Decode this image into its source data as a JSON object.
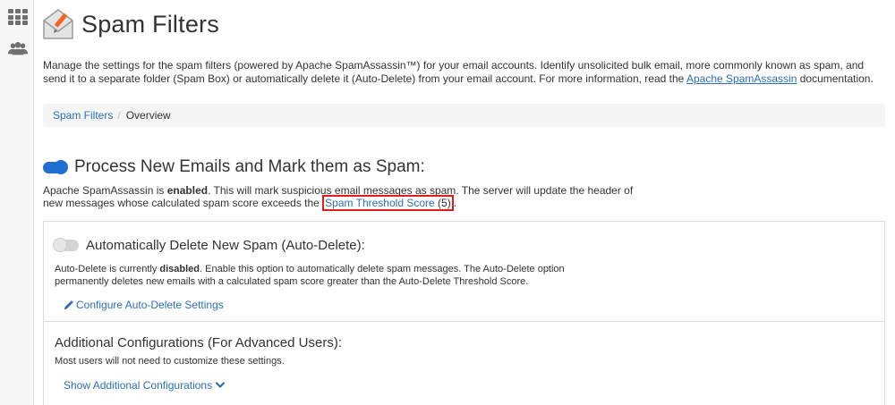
{
  "page": {
    "title": "Spam Filters",
    "description_before_link": "Manage the settings for the spam filters (powered by Apache SpamAssassin™) for your email accounts. Identify unsolicited bulk email, more commonly known as spam, and send it to a separate folder (Spam Box) or automatically delete it (Auto-Delete) from your email account. For more information, read the ",
    "description_link": "Apache SpamAssassin",
    "description_after_link": " documentation."
  },
  "breadcrumb": {
    "parent": "Spam Filters",
    "separator": "/",
    "current": "Overview"
  },
  "process": {
    "title": "Process New Emails and Mark them as Spam:",
    "enabled": true,
    "text_before_status": "Apache SpamAssassin is ",
    "status": "enabled",
    "text_after_status": ". This will mark suspicious email messages as spam. The server will update the header of new messages whose calculated spam score exceeds the ",
    "threshold_link": "Spam Threshold Score",
    "threshold_value": " (5)",
    "end": "."
  },
  "autodelete": {
    "title": "Automatically Delete New Spam (Auto-Delete):",
    "enabled": false,
    "text_before_status": "Auto-Delete is currently ",
    "status": "disabled",
    "text_after_status": ". Enable this option to automatically delete spam messages. The Auto-Delete option permanently deletes new emails with a calculated spam score greater than the Auto-Delete Threshold Score.",
    "configure_link": "Configure Auto-Delete Settings"
  },
  "advanced": {
    "title": "Additional Configurations (For Advanced Users):",
    "description": "Most users will not need to customize these settings.",
    "show_link": "Show Additional Configurations"
  },
  "colors": {
    "accent": "#1f6fd0",
    "link": "#2b6fb6",
    "highlight": "#e21b1b"
  },
  "icons": {
    "sidebar": [
      "grid-icon",
      "users-icon"
    ],
    "logo": "mail-logo-icon",
    "configure": "pencil-icon",
    "expand": "chevron-down-icon"
  }
}
